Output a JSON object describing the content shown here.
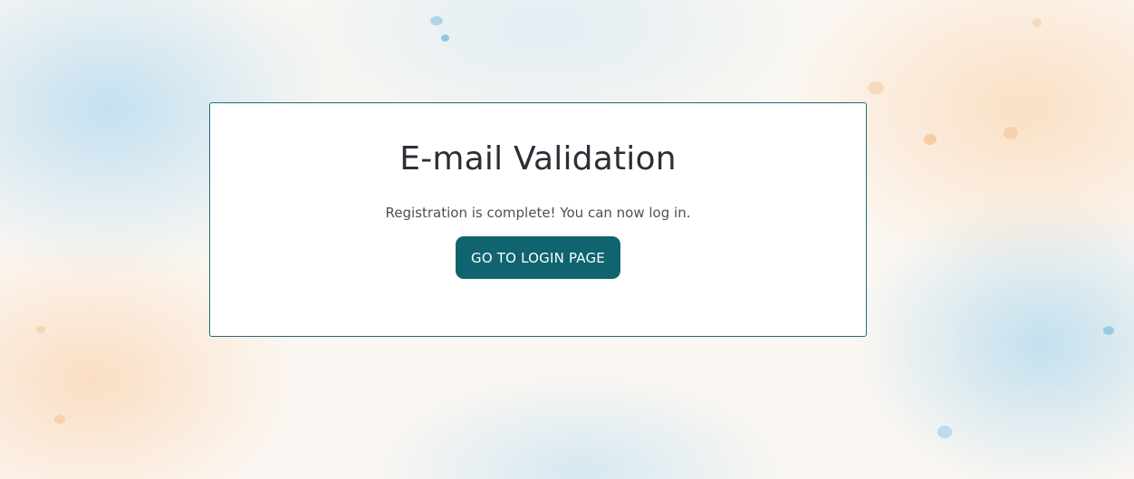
{
  "card": {
    "title": "E-mail Validation",
    "message": "Registration is complete! You can now log in.",
    "login_button_label": "GO TO LOGIN PAGE"
  },
  "colors": {
    "accent": "#0f6470",
    "card_border": "#1f6a72",
    "title_text": "#2b2f36",
    "body_text": "#4b5058"
  }
}
